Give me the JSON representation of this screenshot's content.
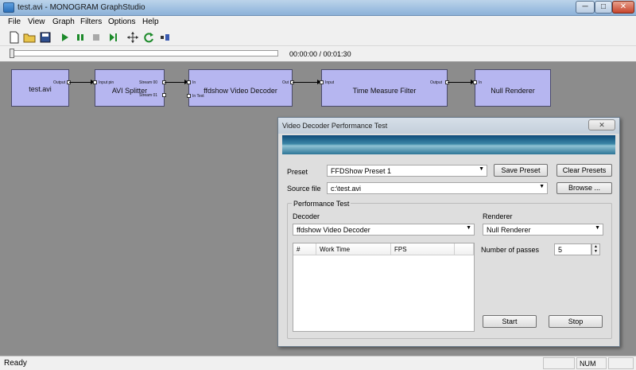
{
  "window": {
    "title": "test.avi - MONOGRAM GraphStudio",
    "minimize": "─",
    "maximize": "□",
    "close": "✕"
  },
  "menu": [
    "File",
    "View",
    "Graph",
    "Filters",
    "Options",
    "Help"
  ],
  "toolbar": [
    "new-file-icon",
    "open-folder-icon",
    "save-icon",
    "play-icon",
    "pause-icon",
    "stop-icon",
    "step-frame-icon",
    "select-pointer-icon",
    "refresh-icon",
    "seek-icon"
  ],
  "seek": {
    "time": "00:00:00 / 00:01:30",
    "position": 0.0
  },
  "graph": {
    "filters": {
      "test_avi": {
        "name": "test.avi",
        "out": "Output"
      },
      "avi_splitter": {
        "name": "AVI Splitter",
        "in": "Input pin",
        "out1": "Stream 00",
        "out2": "Stream 01"
      },
      "ffdshow": {
        "name": "ffdshow Video Decoder",
        "in": "In",
        "in2": "In Text",
        "out": "Out"
      },
      "time_measure": {
        "name": "Time Measure Filter",
        "in": "Input",
        "out": "Output"
      },
      "null_renderer": {
        "name": "Null Renderer",
        "in": "In"
      }
    }
  },
  "dialog": {
    "title": "Video Decoder Performance Test",
    "close": "✕",
    "preset_label": "Preset",
    "preset_value": "FFDShow Preset 1",
    "save_preset": "Save Preset",
    "clear_presets": "Clear Presets",
    "source_label": "Source file",
    "source_value": "c:\\test.avi",
    "browse": "Browse ...",
    "group_label": "Performance Test",
    "decoder_label": "Decoder",
    "decoder_value": "ffdshow Video Decoder",
    "renderer_label": "Renderer",
    "renderer_value": "Null Renderer",
    "columns": [
      "#",
      "Work Time",
      "FPS"
    ],
    "passes_label": "Number of passes",
    "passes_value": "5",
    "start": "Start",
    "stop": "Stop"
  },
  "status": {
    "text": "Ready",
    "num": "NUM"
  }
}
